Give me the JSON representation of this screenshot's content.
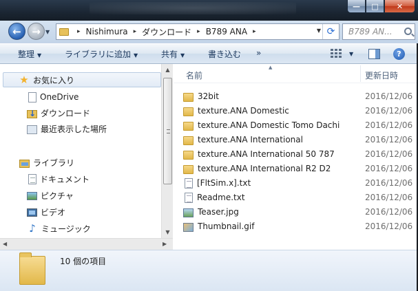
{
  "window": {
    "controls": {
      "minimize": "—",
      "maximize": "□",
      "close": "✕"
    }
  },
  "address": {
    "breadcrumbs": [
      "Nishimura",
      "ダウンロード",
      "B789 ANA"
    ],
    "search_placeholder": "B789 AN..."
  },
  "toolbar": {
    "organize": "整理",
    "add_to_library": "ライブラリに追加",
    "share": "共有",
    "burn": "書き込む",
    "more": "»"
  },
  "nav": {
    "favorites": "お気に入り",
    "onedrive": "OneDrive",
    "downloads": "ダウンロード",
    "recent": "最近表示した場所",
    "libraries": "ライブラリ",
    "documents": "ドキュメント",
    "pictures": "ピクチャ",
    "videos": "ビデオ",
    "music": "ミュージック"
  },
  "columns": {
    "name": "名前",
    "date": "更新日時"
  },
  "files": [
    {
      "name": "32bit",
      "date": "2016/12/06",
      "icon": "folder-icon"
    },
    {
      "name": "texture.ANA Domestic",
      "date": "2016/12/06",
      "icon": "folder-icon"
    },
    {
      "name": "texture.ANA Domestic Tomo Dachi",
      "date": "2016/12/06",
      "icon": "folder-icon"
    },
    {
      "name": "texture.ANA International",
      "date": "2016/12/06",
      "icon": "folder-icon"
    },
    {
      "name": "texture.ANA International 50 787",
      "date": "2016/12/06",
      "icon": "folder-icon"
    },
    {
      "name": "texture.ANA International R2 D2",
      "date": "2016/12/06",
      "icon": "folder-icon"
    },
    {
      "name": "[FltSim.x].txt",
      "date": "2016/12/06",
      "icon": "text-file-icon"
    },
    {
      "name": "Readme.txt",
      "date": "2016/12/06",
      "icon": "text-file-icon"
    },
    {
      "name": "Teaser.jpg",
      "date": "2016/12/06",
      "icon": "image-file-icon"
    },
    {
      "name": "Thumbnail.gif",
      "date": "2016/12/06",
      "icon": "gif-file-icon"
    }
  ],
  "details": {
    "item_count": "10 個の項目"
  }
}
